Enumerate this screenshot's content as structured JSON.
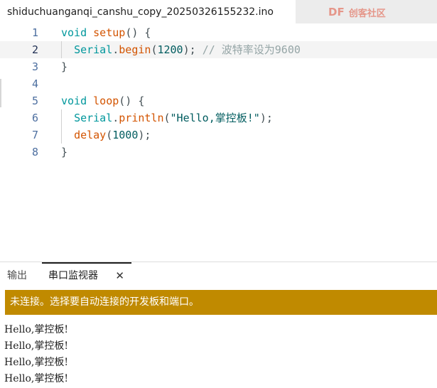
{
  "tab": {
    "filename": "shiduchuanganqi_canshu_copy_20250326155232.ino"
  },
  "watermark": {
    "brand": "DF",
    "name": "创客社区"
  },
  "editor": {
    "line_numbers": [
      "1",
      "2",
      "3",
      "4",
      "5",
      "6",
      "7",
      "8"
    ],
    "active_line": 2,
    "lines": [
      {
        "tokens": [
          [
            "kw",
            "void"
          ],
          [
            "pl",
            " "
          ],
          [
            "fn",
            "setup"
          ],
          [
            "pl",
            "() {"
          ]
        ]
      },
      {
        "tokens": [
          [
            "pl",
            "  "
          ],
          [
            "kw",
            "Serial"
          ],
          [
            "pl",
            "."
          ],
          [
            "fn",
            "begin"
          ],
          [
            "pl",
            "("
          ],
          [
            "num",
            "1200"
          ],
          [
            "pl",
            "); "
          ],
          [
            "cm",
            "// 波特率设为9600"
          ]
        ]
      },
      {
        "tokens": [
          [
            "pl",
            "}"
          ]
        ]
      },
      {
        "tokens": []
      },
      {
        "tokens": [
          [
            "kw",
            "void"
          ],
          [
            "pl",
            " "
          ],
          [
            "fn",
            "loop"
          ],
          [
            "pl",
            "() {"
          ]
        ]
      },
      {
        "tokens": [
          [
            "pl",
            "  "
          ],
          [
            "kw",
            "Serial"
          ],
          [
            "pl",
            "."
          ],
          [
            "fn",
            "println"
          ],
          [
            "pl",
            "("
          ],
          [
            "str",
            "\"Hello,掌控板!\""
          ],
          [
            "pl",
            ");"
          ]
        ]
      },
      {
        "tokens": [
          [
            "pl",
            "  "
          ],
          [
            "fn",
            "delay"
          ],
          [
            "pl",
            "("
          ],
          [
            "num",
            "1000"
          ],
          [
            "pl",
            ");"
          ]
        ]
      },
      {
        "tokens": [
          [
            "pl",
            "}"
          ]
        ]
      }
    ]
  },
  "panel": {
    "tabs": {
      "output": "输出",
      "serial_monitor": "串口监视器",
      "close": "✕"
    },
    "banner": "未连接。选择要自动连接的开发板和端口。",
    "output_lines": [
      "Hello,掌控板!",
      "Hello,掌控板!",
      "Hello,掌控板!",
      "Hello,掌控板!"
    ],
    "banner_color": "#c08a00"
  }
}
